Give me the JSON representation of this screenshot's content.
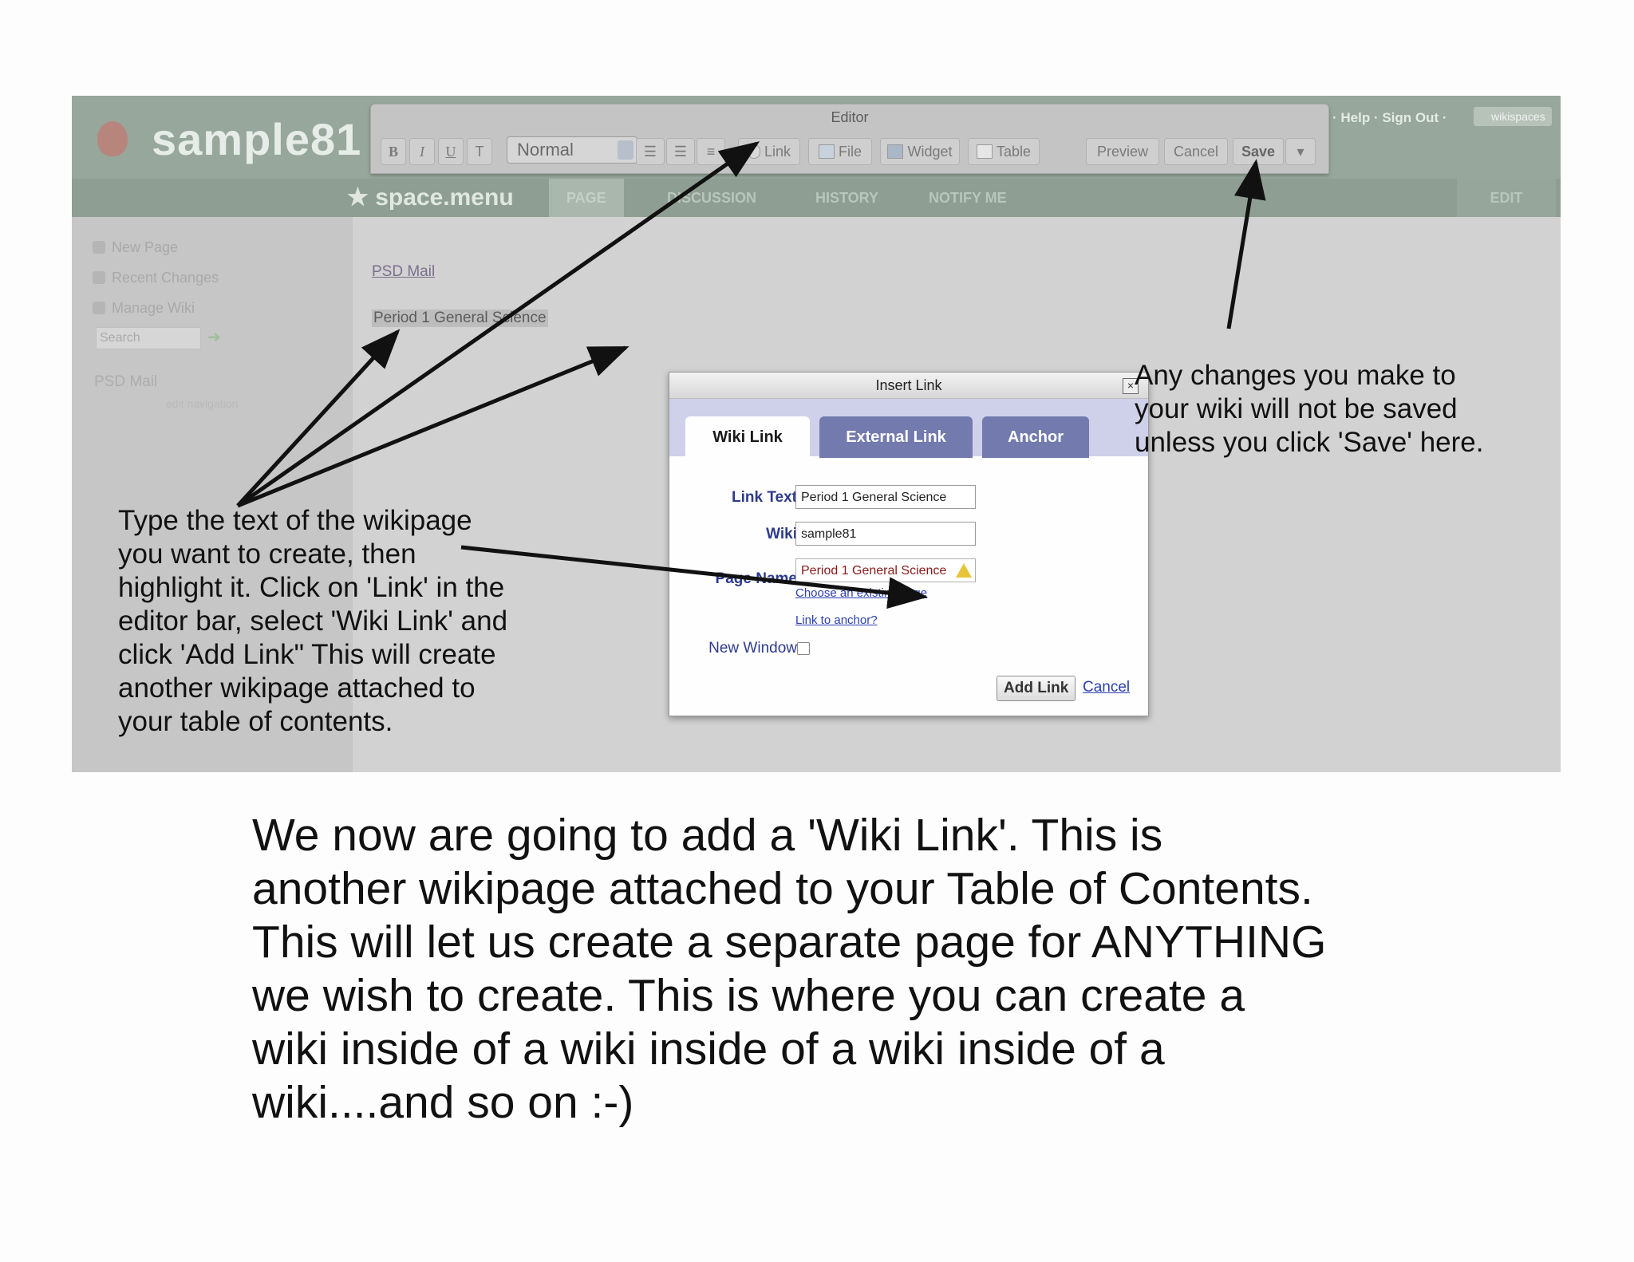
{
  "site": {
    "name": "sample81",
    "top_links": "· Help · Sign Out ·",
    "badge": "wikispaces"
  },
  "nav": {
    "space_menu": "★ space.menu",
    "tabs": [
      "PAGE",
      "DISCUSSION",
      "HISTORY",
      "NOTIFY ME"
    ],
    "edit": "EDIT"
  },
  "sidebar": {
    "items": [
      "New Page",
      "Recent Changes",
      "Manage Wiki"
    ],
    "search_placeholder": "Search",
    "psd_mail": "PSD Mail",
    "edit_navigation": "edit navigation"
  },
  "content": {
    "link1": "PSD Mail",
    "selected_text": "Period 1 General Science"
  },
  "editor": {
    "title": "Editor",
    "bold": "B",
    "italic": "I",
    "underline": "U",
    "style_value": "Normal",
    "link": "Link",
    "file": "File",
    "widget": "Widget",
    "table": "Table",
    "preview": "Preview",
    "cancel": "Cancel",
    "save": "Save",
    "more": "▾"
  },
  "dialog": {
    "title": "Insert Link",
    "close": "×",
    "tabs": {
      "wiki_link": "Wiki Link",
      "external_link": "External Link",
      "anchor": "Anchor"
    },
    "labels": {
      "link_text": "Link Text",
      "wiki": "Wiki",
      "page_name": "Page Name",
      "new_window": "New Window"
    },
    "values": {
      "link_text": "Period 1 General Science",
      "wiki": "sample81",
      "page_name": "Period 1 General Science"
    },
    "choose_existing": "Choose an existing page",
    "link_to_anchor": "Link to anchor?",
    "add_link": "Add Link",
    "cancel": "Cancel"
  },
  "annotations": {
    "left": [
      "Type the text of the wikipage",
      "you want to create, then",
      "highlight it.  Click on 'Link' in the",
      "editor bar, select 'Wiki Link' and",
      "click 'Add Link\"  This will create",
      "another wikipage attached to",
      "your table of contents."
    ],
    "right": [
      "Any changes you make to",
      "your wiki will not be saved",
      "unless you click 'Save' here."
    ]
  },
  "body_text": [
    "We now are going to add a 'Wiki Link'.  This is",
    "another wikipage attached to your Table of Contents.",
    "This will let us create a separate page for ANYTHING",
    "we wish to create.  This is where you can create a",
    "wiki inside of a wiki inside of a wiki inside of a",
    "wiki....and so on :-)"
  ]
}
